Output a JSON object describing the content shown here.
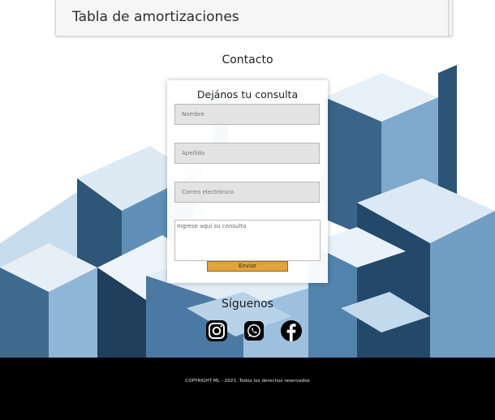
{
  "amortization": {
    "title": "Tabla de amortizaciones"
  },
  "contact": {
    "title": "Contacto",
    "form_heading": "Dejános tu consulta",
    "name_placeholder": "Nombre",
    "lastname_placeholder": "Apellido",
    "email_placeholder": "Correo electrónico",
    "message_placeholder": "Ingrese aquí su consulta",
    "send_label": "Enviar"
  },
  "social": {
    "title": "Síguenos",
    "icons": [
      "instagram-icon",
      "whatsapp-icon",
      "facebook-icon"
    ]
  },
  "footer": {
    "copyright": "COPYRIGHT ML - 2021. Todos los derechos reservados"
  },
  "colors": {
    "footer_bg": "#000000",
    "send_button": "#e0a43a",
    "cube_dark": "#2b4f6f",
    "cube_light": "#a9c9e2"
  }
}
